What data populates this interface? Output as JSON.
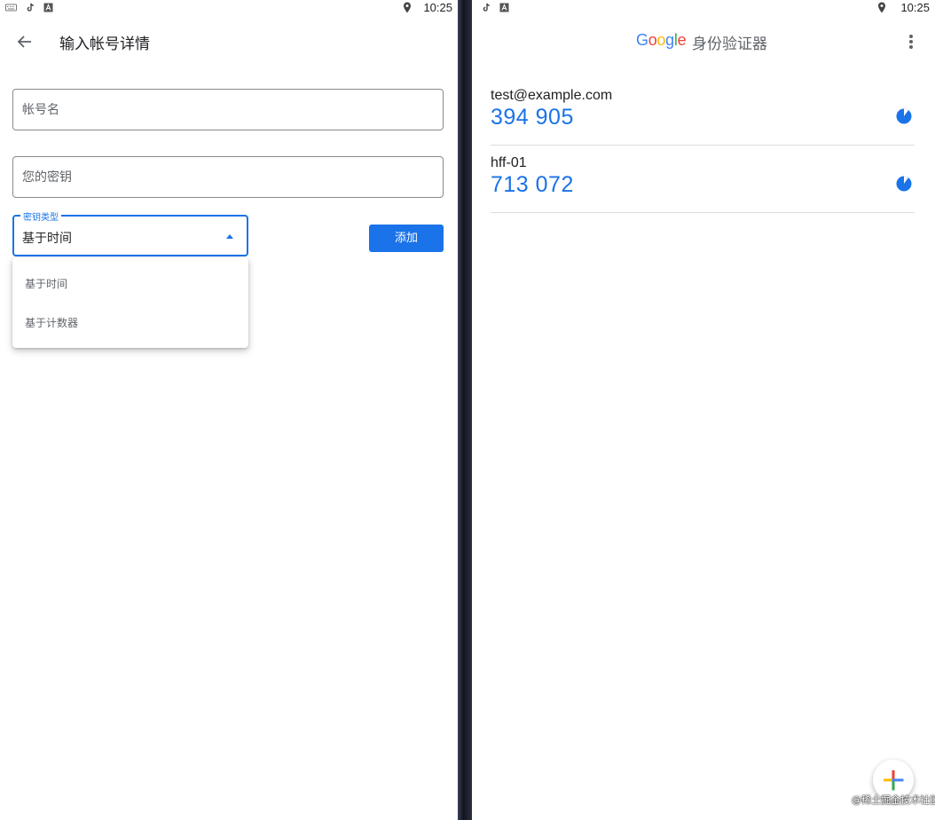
{
  "left": {
    "status": {
      "time": "10:25"
    },
    "appbar": {
      "title": "输入帐号详情"
    },
    "form": {
      "account_placeholder": "帐号名",
      "secret_placeholder": "您的密钥",
      "key_type_label": "密钥类型",
      "key_type_value": "基于时间",
      "add_button": "添加",
      "dropdown_options": [
        "基于时间",
        "基于计数器"
      ]
    }
  },
  "right": {
    "status": {
      "time": "10:25"
    },
    "header": {
      "logo": "Google",
      "title": "身份验证器"
    },
    "accounts": [
      {
        "name": "test@example.com",
        "code": "394 905"
      },
      {
        "name": "hff-01",
        "code": "713 072"
      }
    ],
    "watermark": "@稀土掘金技术社区"
  },
  "colors": {
    "accent": "#1a73e8",
    "google_blue": "#4285f4",
    "google_red": "#ea4335",
    "google_yellow": "#fbbc05",
    "google_green": "#34a853"
  },
  "icons": [
    "keyboard-icon",
    "tiktok-icon",
    "a-box-icon",
    "location-icon",
    "back-arrow-icon",
    "dropdown-arrow-icon",
    "more-vert-icon",
    "timer-pie-icon",
    "plus-icon"
  ]
}
